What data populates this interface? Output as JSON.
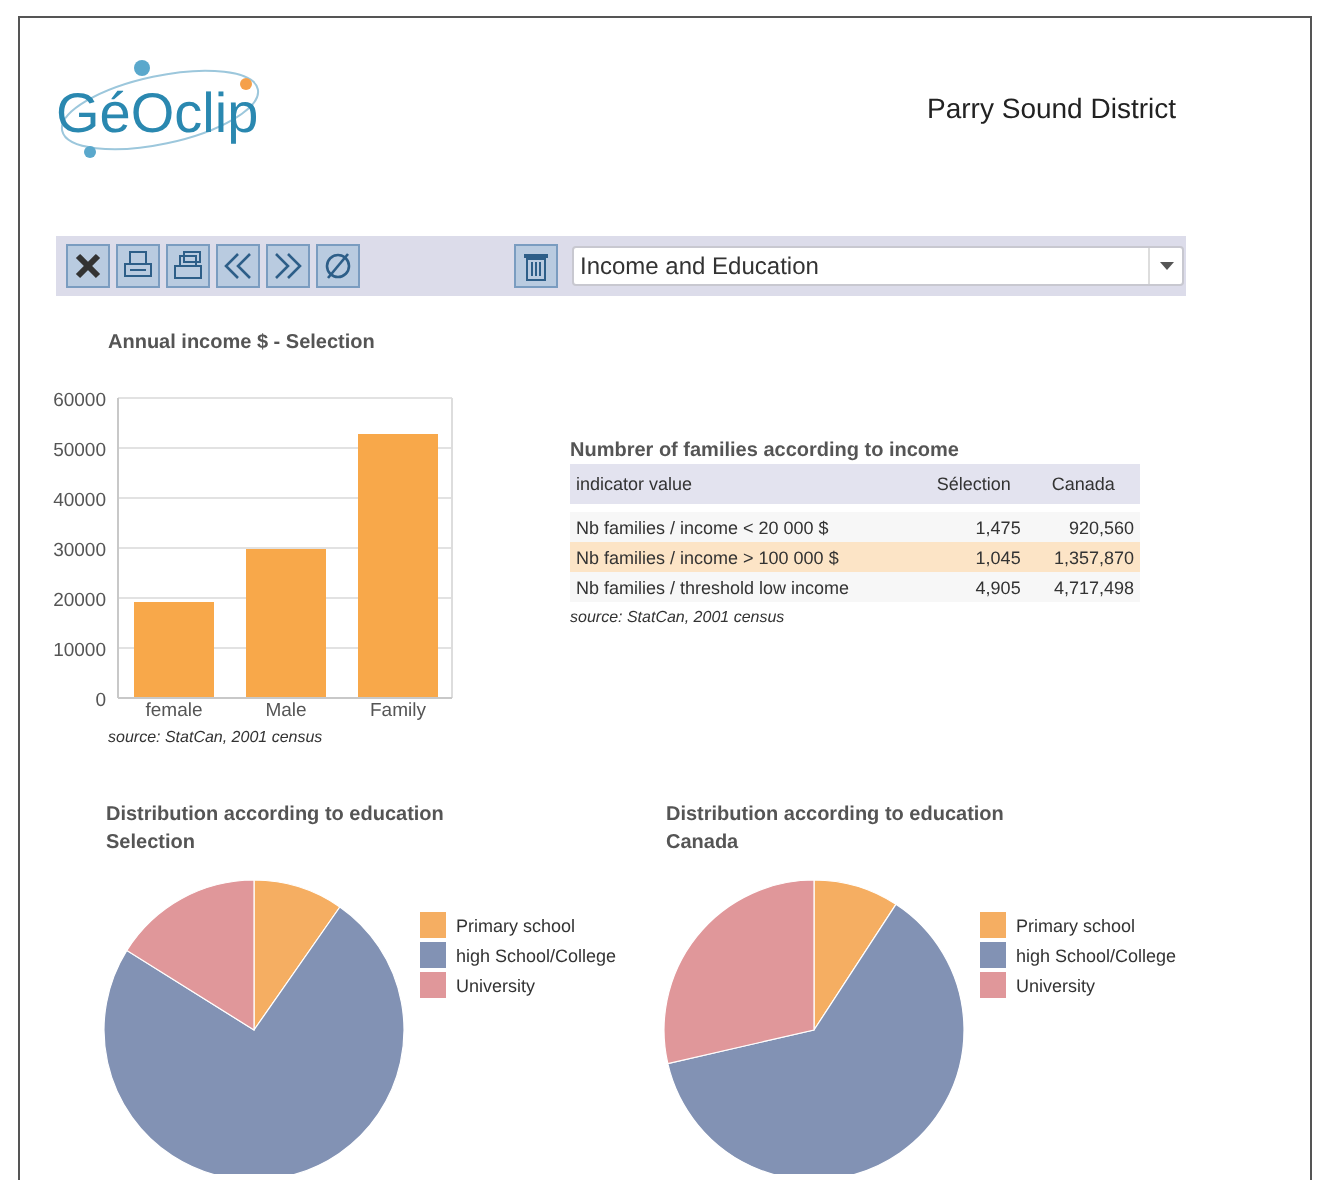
{
  "header": {
    "logo": "GéOclip",
    "place": "Parry Sound District"
  },
  "toolbar": {
    "theme_select": {
      "value": "Income and Education"
    }
  },
  "income_chart": {
    "chart_data": {
      "type": "bar",
      "title": "Annual income $ - Selection",
      "categories": [
        "female",
        "Male",
        "Family"
      ],
      "values": [
        19200,
        29800,
        52800
      ],
      "ylim": [
        0,
        60000
      ],
      "grid": true,
      "yticks": [
        0,
        10000,
        20000,
        30000,
        40000,
        50000,
        60000
      ]
    },
    "source": "source: StatCan, 2001 census"
  },
  "families_table": {
    "title": "Numbrer of families according to income",
    "columns": [
      "indicator value",
      "Sélection",
      "Canada"
    ],
    "rows": [
      {
        "cells": [
          "Nb families / income < 20 000 $",
          "1,475",
          "920,560"
        ],
        "selected": false
      },
      {
        "cells": [
          "Nb families / income > 100 000 $",
          "1,045",
          "1,357,870"
        ],
        "selected": true
      },
      {
        "cells": [
          "Nb families / threshold low income",
          "4,905",
          "4,717,498"
        ],
        "selected": false
      }
    ],
    "source": "source: StatCan, 2001 census"
  },
  "education_charts": [
    {
      "title": [
        "Distribution according to education",
        "Selection"
      ],
      "legend": [
        {
          "label": "Primary school",
          "color": "#f5ae62"
        },
        {
          "label": "high School/College",
          "color": "#8292b4"
        },
        {
          "label": "University",
          "color": "#e0979a"
        }
      ]
    },
    {
      "title": [
        "Distribution according to education",
        "Canada"
      ],
      "legend": [
        {
          "label": "Primary school",
          "color": "#f5ae62"
        },
        {
          "label": "high School/College",
          "color": "#8292b4"
        },
        {
          "label": "University",
          "color": "#e0979a"
        }
      ]
    }
  ]
}
